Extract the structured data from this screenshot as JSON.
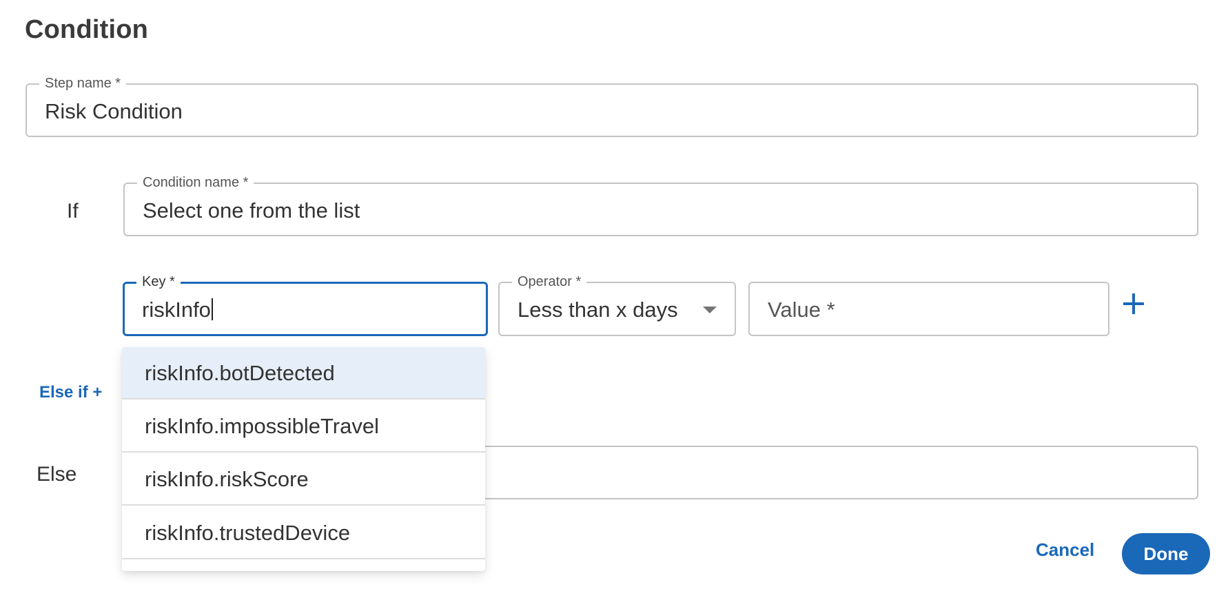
{
  "page": {
    "title": "Condition"
  },
  "step_name": {
    "label": "Step name *",
    "value": "Risk Condition"
  },
  "if_row": {
    "label": "If",
    "condition_name": {
      "label": "Condition name *",
      "value": "Select one from the list"
    }
  },
  "rule": {
    "key": {
      "label": "Key *",
      "value": "riskInfo"
    },
    "operator": {
      "label": "Operator *",
      "value": "Less than x days"
    },
    "value": {
      "placeholder": "Value *"
    },
    "add_icon": "plus-icon"
  },
  "key_suggestions": {
    "options": [
      {
        "label": "riskInfo.botDetected",
        "highlighted": true
      },
      {
        "label": "riskInfo.impossibleTravel",
        "highlighted": false
      },
      {
        "label": "riskInfo.riskScore",
        "highlighted": false
      },
      {
        "label": "riskInfo.trustedDevice",
        "highlighted": false
      }
    ]
  },
  "else_if": {
    "label": "Else if +"
  },
  "else_row": {
    "label": "Else",
    "value": ""
  },
  "footer": {
    "cancel_label": "Cancel",
    "done_label": "Done"
  },
  "colors": {
    "accent": "#1a68b8",
    "highlight": "#e6eff9",
    "border": "#c4c4c4",
    "text": "#333333"
  }
}
